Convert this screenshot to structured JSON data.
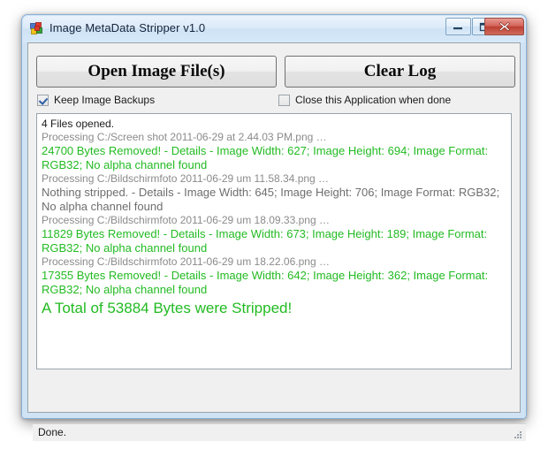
{
  "window": {
    "title": "Image MetaData Stripper v1.0",
    "icon": "app-blocks-icon",
    "controls": {
      "minimize": "minimize-icon",
      "maximize": "maximize-icon",
      "close": "close-icon"
    }
  },
  "toolbar": {
    "open_label": "Open Image File(s)",
    "clear_label": "Clear Log"
  },
  "options": {
    "keep_backups": {
      "label": "Keep Image Backups",
      "checked": true
    },
    "close_when_done": {
      "label": "Close this Application when done",
      "checked": false
    }
  },
  "log": {
    "lines": [
      {
        "style": "plain",
        "text": "4 Files opened."
      },
      {
        "style": "proc",
        "text": "Processing C:/Screen shot 2011-06-29 at 2.44.03 PM.png …"
      },
      {
        "style": "green",
        "text": "24700 Bytes Removed! - Details - Image Width: 627; Image Height: 694; Image Format: RGB32; No alpha channel found"
      },
      {
        "style": "proc",
        "text": "Processing C:/Bildschirmfoto 2011-06-29 um 11.58.34.png …"
      },
      {
        "style": "gray",
        "text": "Nothing stripped. - Details - Image Width: 645; Image Height: 706; Image Format: RGB32; No alpha channel found"
      },
      {
        "style": "proc",
        "text": "Processing C:/Bildschirmfoto 2011-06-29 um 18.09.33.png …"
      },
      {
        "style": "green",
        "text": "11829 Bytes Removed! - Details - Image Width: 673; Image Height: 189; Image Format: RGB32; No alpha channel found"
      },
      {
        "style": "proc",
        "text": "Processing C:/Bildschirmfoto 2011-06-29 um 18.22.06.png …"
      },
      {
        "style": "green",
        "text": "17355 Bytes Removed! - Details - Image Width: 642; Image Height: 362; Image Format: RGB32; No alpha channel found"
      },
      {
        "style": "total",
        "text": "A Total of 53884 Bytes were Stripped!"
      }
    ]
  },
  "statusbar": {
    "text": "Done.",
    "grip": "resize-grip-icon"
  },
  "colors": {
    "success_green": "#22bb22",
    "processing_gray": "#8b8b8b",
    "neutral_gray": "#6e6e6e",
    "titlebar_blue": "#cfe3f5",
    "close_red": "#bc3f33"
  }
}
